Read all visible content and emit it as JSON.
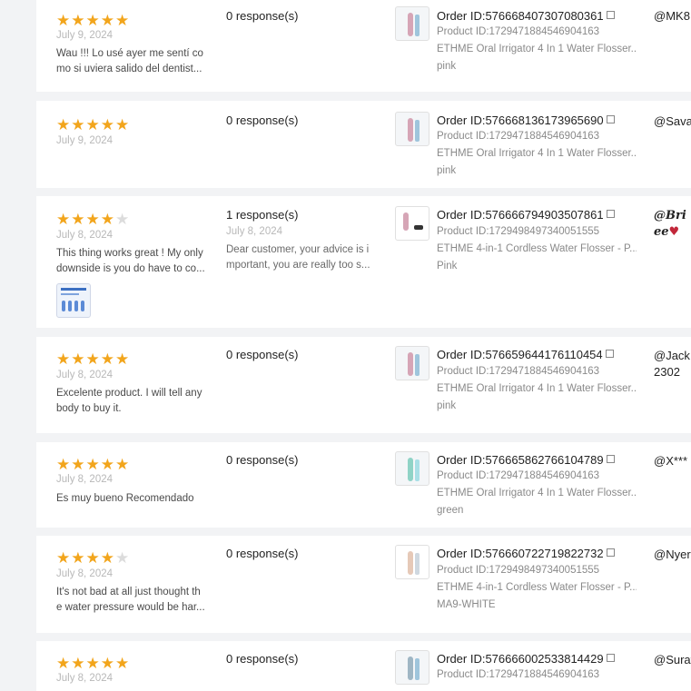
{
  "reviews": [
    {
      "stars": 5,
      "date": "July 9, 2024",
      "text": "Wau !!! Lo usé ayer me sentí co\nmo si uviera salido del dentist...",
      "response_count": "0 response(s)",
      "order_id": "Order ID:576668407307080361",
      "product_id": "Product ID:1729471884546904163",
      "product_name": "ETHME Oral Irrigator 4 In 1 Water Flosser...",
      "variant": "pink",
      "user": "@MK8"
    },
    {
      "stars": 5,
      "date": "July 9, 2024",
      "text": "",
      "response_count": "0 response(s)",
      "order_id": "Order ID:576668136173965690",
      "product_id": "Product ID:1729471884546904163",
      "product_name": "ETHME Oral Irrigator 4 In 1 Water Flosser...",
      "variant": "pink",
      "user": "@Sava"
    },
    {
      "stars": 4,
      "date": "July 8, 2024",
      "text": "This thing works great ! My only\ndownside is you do have to co...",
      "response_count": "1 response(s)",
      "response_date": "July 8, 2024",
      "response_text": "Dear customer, your advice is i\nmportant, you are really too s...",
      "order_id": "Order ID:576666794903507861",
      "product_id": "Product ID:1729498497340051555",
      "product_name": "ETHME 4-in-1 Cordless Water Flosser - P...",
      "variant": "Pink",
      "user": "@Bri",
      "user_line2": "ee"
    },
    {
      "stars": 5,
      "date": "July 8, 2024",
      "text": "Excelente product. I will tell any\nbody to buy it.",
      "response_count": "0 response(s)",
      "order_id": "Order ID:576659644176110454",
      "product_id": "Product ID:1729471884546904163",
      "product_name": "ETHME Oral Irrigator 4 In 1 Water Flosser...",
      "variant": "pink",
      "user": "@Jack\n2302"
    },
    {
      "stars": 5,
      "date": "July 8, 2024",
      "text": "Es muy bueno Recomendado",
      "response_count": "0 response(s)",
      "order_id": "Order ID:576665862766104789",
      "product_id": "Product ID:1729471884546904163",
      "product_name": "ETHME Oral Irrigator 4 In 1 Water Flosser...",
      "variant": "green",
      "user": "@X***"
    },
    {
      "stars": 4,
      "date": "July 8, 2024",
      "text": "It's not bad at all just thought th\ne water pressure would be har...",
      "response_count": "0 response(s)",
      "order_id": "Order ID:576660722719822732",
      "product_id": "Product ID:1729498497340051555",
      "product_name": "ETHME 4-in-1 Cordless Water Flosser - P...",
      "variant": "MA9-WHITE",
      "user": "@Nyer"
    },
    {
      "stars": 5,
      "date": "July 8, 2024",
      "text": "",
      "response_count": "0 response(s)",
      "order_id": "Order ID:576666002533814429",
      "product_id": "Product ID:1729471884546904163",
      "product_name": "",
      "variant": "",
      "user": "@Surat"
    }
  ],
  "colors": {
    "star": "#f2a51c",
    "star_empty": "#dcdcdc",
    "background": "#f2f3f5"
  },
  "icons": {
    "star": "star-icon",
    "copy": "copy-icon",
    "heart": "heart-icon"
  }
}
